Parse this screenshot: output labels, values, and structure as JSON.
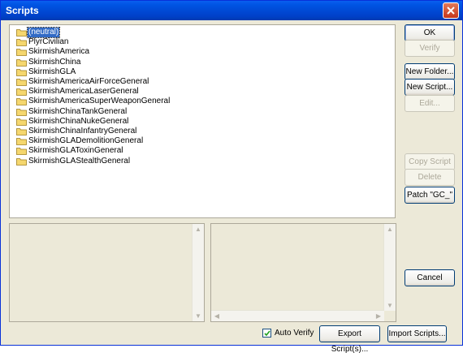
{
  "window": {
    "title": "Scripts"
  },
  "tree": {
    "items": [
      {
        "label": "(neutral)",
        "selected": true
      },
      {
        "label": "PlyrCivilian"
      },
      {
        "label": "SkirmishAmerica"
      },
      {
        "label": "SkirmishChina"
      },
      {
        "label": "SkirmishGLA"
      },
      {
        "label": "SkirmishAmericaAirForceGeneral"
      },
      {
        "label": "SkirmishAmericaLaserGeneral"
      },
      {
        "label": "SkirmishAmericaSuperWeaponGeneral"
      },
      {
        "label": "SkirmishChinaTankGeneral"
      },
      {
        "label": "SkirmishChinaNukeGeneral"
      },
      {
        "label": "SkirmishChinaInfantryGeneral"
      },
      {
        "label": "SkirmishGLADemolitionGeneral"
      },
      {
        "label": "SkirmishGLAToxinGeneral"
      },
      {
        "label": "SkirmishGLAStealthGeneral"
      }
    ]
  },
  "buttons": {
    "ok": "OK",
    "verify": "Verify",
    "new_folder": "New Folder...",
    "new_script": "New Script...",
    "edit": "Edit...",
    "copy_script": "Copy Script",
    "delete": "Delete",
    "patch": "Patch \"GC_\"",
    "cancel": "Cancel",
    "export": "Export Script(s)...",
    "import": "Import Scripts..."
  },
  "auto_verify": {
    "label": "Auto Verify",
    "checked": true
  },
  "colors": {
    "title_bar": "#0054e3",
    "selection": "#316ac5",
    "dialog_bg": "#ece9d8",
    "folder": "#f5d76e"
  },
  "icons": {
    "tree_item": "folder-icon",
    "close": "close-icon",
    "check": "checkmark-icon"
  }
}
